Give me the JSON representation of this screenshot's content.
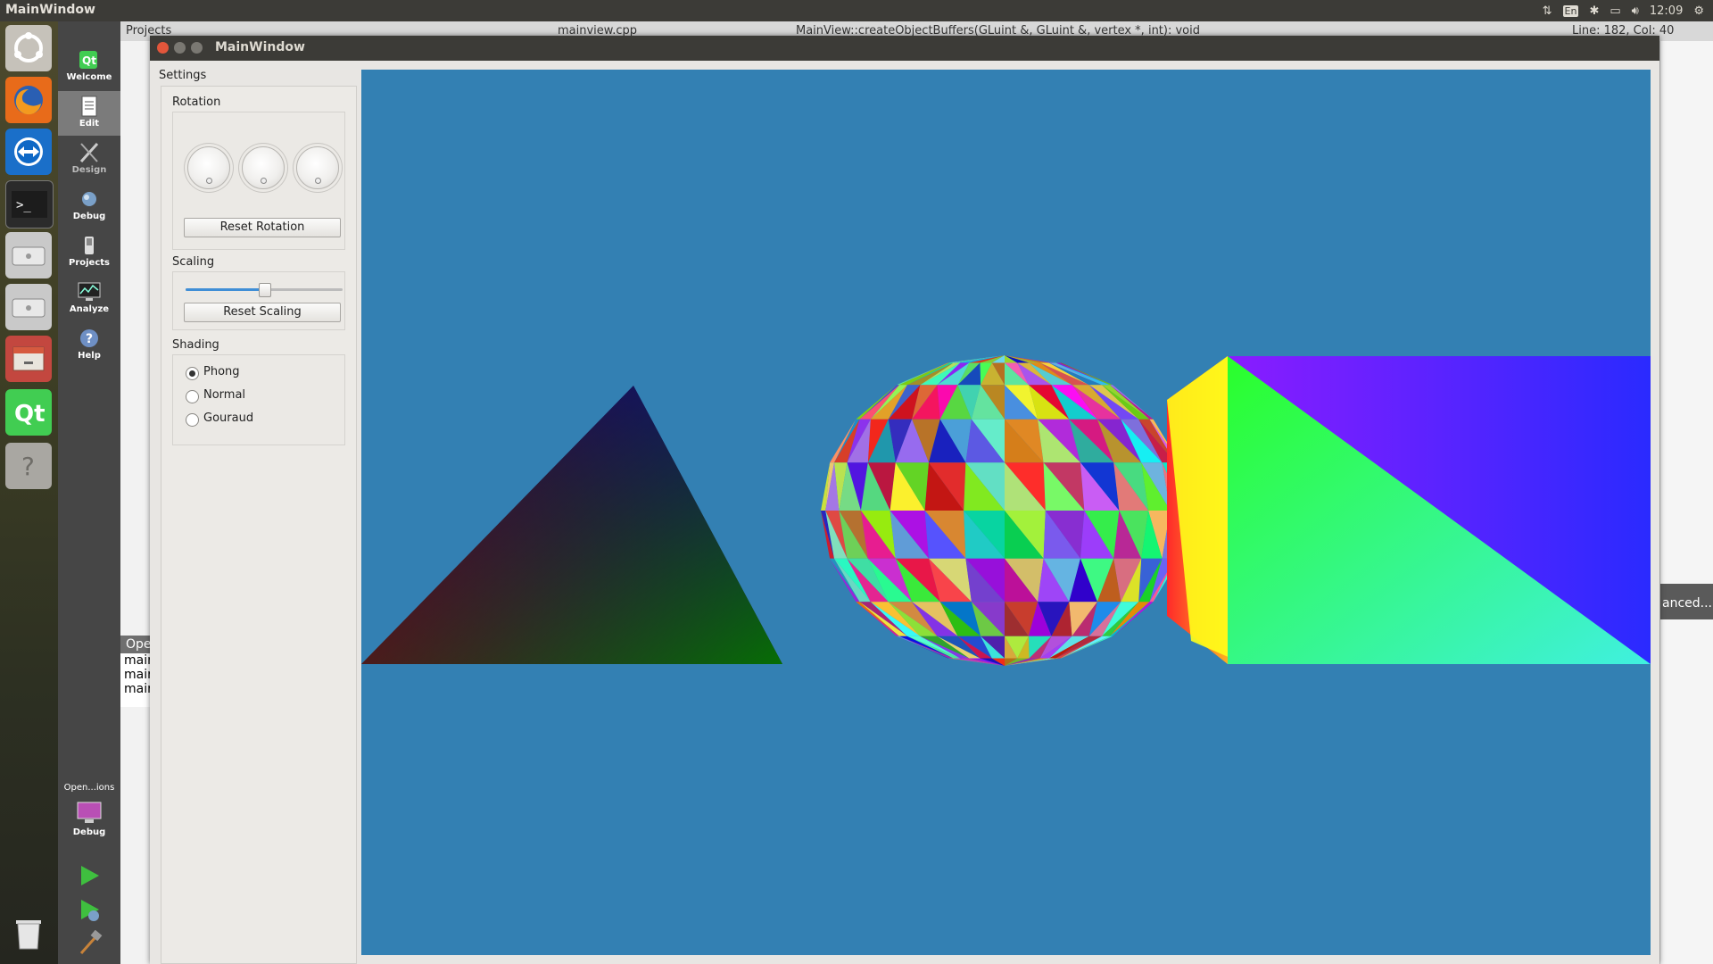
{
  "topbar": {
    "title": "MainWindow",
    "keyboard": "En",
    "time": "12:09"
  },
  "launcher": {
    "items": [
      "ubuntu-dash",
      "firefox",
      "teamviewer",
      "terminal",
      "disk",
      "disk",
      "files",
      "qt-creator",
      "unknown-app",
      "trash"
    ]
  },
  "qt_sidebar": {
    "modes": [
      {
        "label": "Welcome",
        "icon": "qt-welcome-icon"
      },
      {
        "label": "Edit",
        "icon": "edit-document-icon"
      },
      {
        "label": "Design",
        "icon": "design-pen-icon"
      },
      {
        "label": "Debug",
        "icon": "bug-icon"
      },
      {
        "label": "Projects",
        "icon": "wrench-icon"
      },
      {
        "label": "Analyze",
        "icon": "monitor-chart-icon"
      },
      {
        "label": "Help",
        "icon": "help-icon"
      }
    ],
    "target": {
      "name": "Open...ions",
      "config": "Debug"
    }
  },
  "ide": {
    "projects_label": "Projects",
    "file_tab": "mainview.cpp",
    "function_tab": "MainView::createObjectBuffers(GLuint &, GLuint &, vertex *, int): void",
    "position": "Line: 182, Col: 40",
    "output_header": "Ope",
    "output_lines": [
      "mair",
      "mair",
      "mair"
    ],
    "right_text": "anced..."
  },
  "window": {
    "title": "MainWindow",
    "settings_title": "Settings",
    "rotation": {
      "title": "Rotation",
      "reset_label": "Reset Rotation",
      "dials": [
        0,
        0,
        0
      ]
    },
    "scaling": {
      "title": "Scaling",
      "reset_label": "Reset Scaling",
      "value": 0.5
    },
    "shading": {
      "title": "Shading",
      "options": [
        {
          "label": "Phong",
          "checked": true
        },
        {
          "label": "Normal",
          "checked": false
        },
        {
          "label": "Gouraud",
          "checked": false
        }
      ]
    },
    "viewport": {
      "background": "#3380b3"
    }
  }
}
